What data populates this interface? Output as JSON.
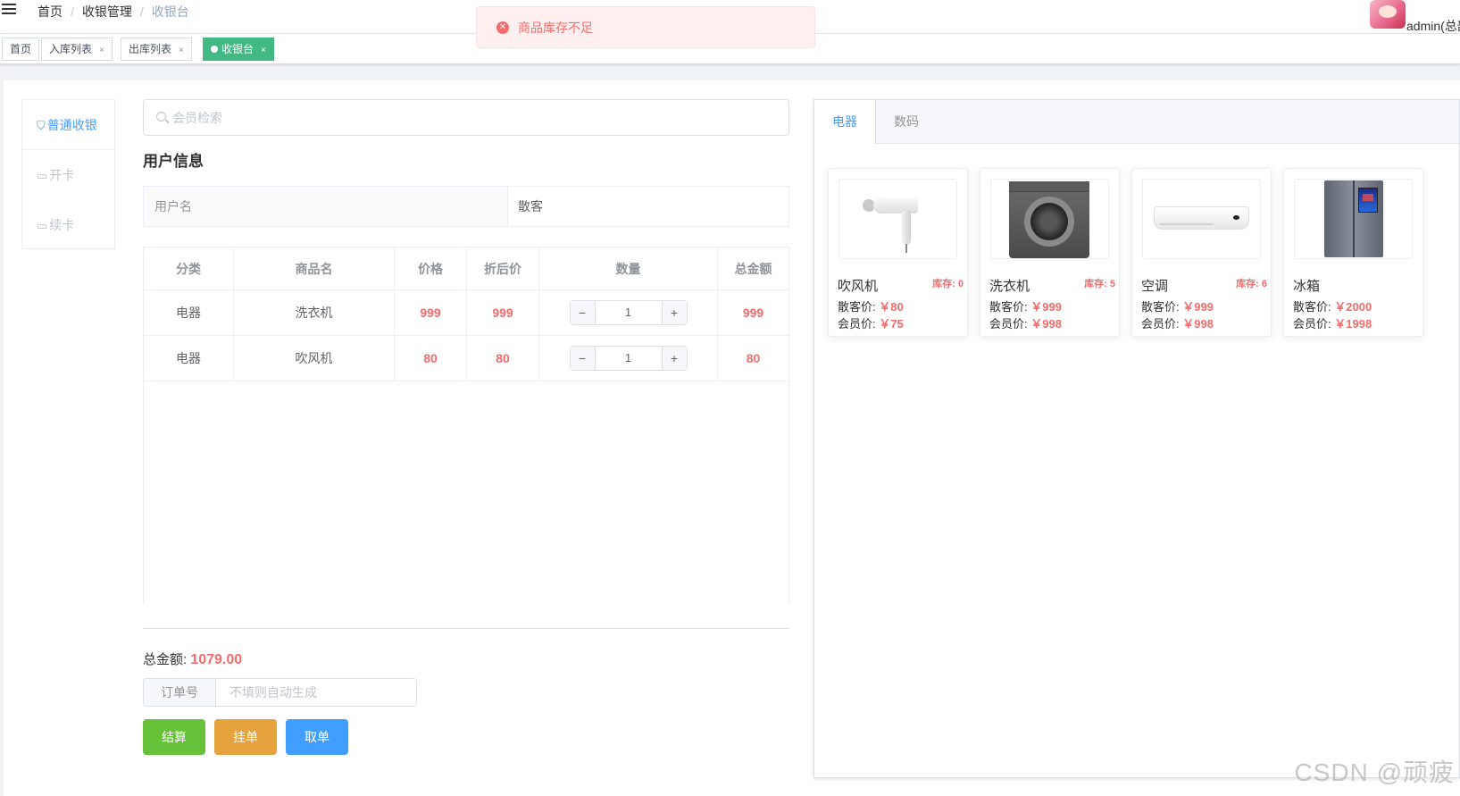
{
  "breadcrumb": [
    "首页",
    "收银管理",
    "收银台"
  ],
  "user": {
    "name": "admin(总部"
  },
  "tabs": [
    {
      "label": "首页",
      "closable": false,
      "active": false
    },
    {
      "label": "入库列表",
      "closable": true,
      "active": false
    },
    {
      "label": "出库列表",
      "closable": true,
      "active": false
    },
    {
      "label": "收银台",
      "closable": true,
      "active": true
    }
  ],
  "tab_close_glyph": "×",
  "message": {
    "type": "error",
    "text": "商品库存不足"
  },
  "side_menu": [
    {
      "label": "普通收银",
      "icon": "shopping-bag-icon",
      "active": true
    },
    {
      "label": "开卡",
      "icon": "card-icon",
      "active": false
    },
    {
      "label": "续卡",
      "icon": "card-icon",
      "active": false
    }
  ],
  "search": {
    "placeholder": "会员检索",
    "value": ""
  },
  "user_info": {
    "title": "用户信息",
    "label": "用户名",
    "value": "散客"
  },
  "cart": {
    "columns": [
      "分类",
      "商品名",
      "价格",
      "折后价",
      "数量",
      "总金额"
    ],
    "rows": [
      {
        "category": "电器",
        "name": "洗衣机",
        "price": "999",
        "discount_price": "999",
        "qty": "1",
        "total": "999"
      },
      {
        "category": "电器",
        "name": "吹风机",
        "price": "80",
        "discount_price": "80",
        "qty": "1",
        "total": "80"
      }
    ],
    "stepper_minus": "−",
    "stepper_plus": "+"
  },
  "summary": {
    "total_label": "总金额:",
    "total_value": "1079.00"
  },
  "order": {
    "label": "订单号",
    "placeholder": "不填则自动生成",
    "value": ""
  },
  "buttons": {
    "settle": "结算",
    "hold": "挂单",
    "cancel": "取单"
  },
  "colors": {
    "settle": "#67c23a",
    "hold": "#e6a23c",
    "cancel": "#409eff",
    "price": "#f56c6c",
    "active_tag": "#42b983",
    "primary": "#409eff"
  },
  "product_tabs": [
    {
      "label": "电器",
      "active": true
    },
    {
      "label": "数码",
      "active": false
    }
  ],
  "products": [
    {
      "name": "吹风机",
      "stock_label": "库存: 0",
      "guest_label": "散客价:",
      "guest_price": "￥80",
      "member_label": "会员价:",
      "member_price": "￥75",
      "image": "hair-dryer"
    },
    {
      "name": "洗衣机",
      "stock_label": "库存: 5",
      "guest_label": "散客价:",
      "guest_price": "￥999",
      "member_label": "会员价:",
      "member_price": "￥998",
      "image": "washing-machine"
    },
    {
      "name": "空调",
      "stock_label": "库存: 6",
      "guest_label": "散客价:",
      "guest_price": "￥999",
      "member_label": "会员价:",
      "member_price": "￥998",
      "image": "air-conditioner"
    },
    {
      "name": "冰箱",
      "stock_label": "",
      "guest_label": "散客价:",
      "guest_price": "￥2000",
      "member_label": "会员价:",
      "member_price": "￥1998",
      "image": "refrigerator"
    }
  ],
  "watermark": "CSDN @顽疲"
}
